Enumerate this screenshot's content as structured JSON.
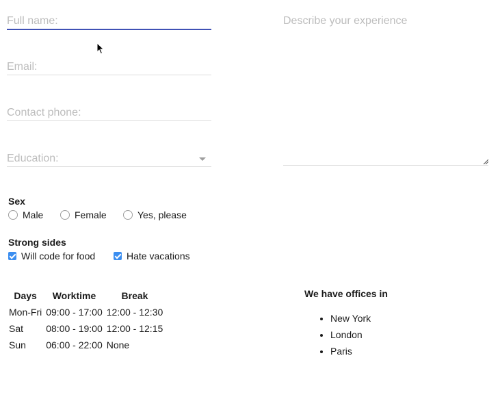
{
  "form": {
    "full_name_placeholder": "Full name:",
    "email_placeholder": "Email:",
    "phone_placeholder": "Contact phone:",
    "education_placeholder": "Education:",
    "experience_placeholder": "Describe your experience"
  },
  "sex": {
    "title": "Sex",
    "options": [
      "Male",
      "Female",
      "Yes, please"
    ]
  },
  "strong_sides": {
    "title": "Strong sides",
    "options": [
      "Will code for food",
      "Hate vacations"
    ]
  },
  "schedule": {
    "headers": [
      "Days",
      "Worktime",
      "Break"
    ],
    "rows": [
      [
        "Mon-Fri",
        "09:00 - 17:00",
        "12:00 - 12:30"
      ],
      [
        "Sat",
        "08:00 - 19:00",
        "12:00 - 12:15"
      ],
      [
        "Sun",
        "06:00 - 22:00",
        "None"
      ]
    ]
  },
  "offices": {
    "title": "We have offices in",
    "cities": [
      "New York",
      "London",
      "Paris"
    ]
  },
  "colors": {
    "focus_underline": "#3f51b5",
    "checkbox": "#3b8ef0",
    "placeholder": "#bdbdbd"
  }
}
